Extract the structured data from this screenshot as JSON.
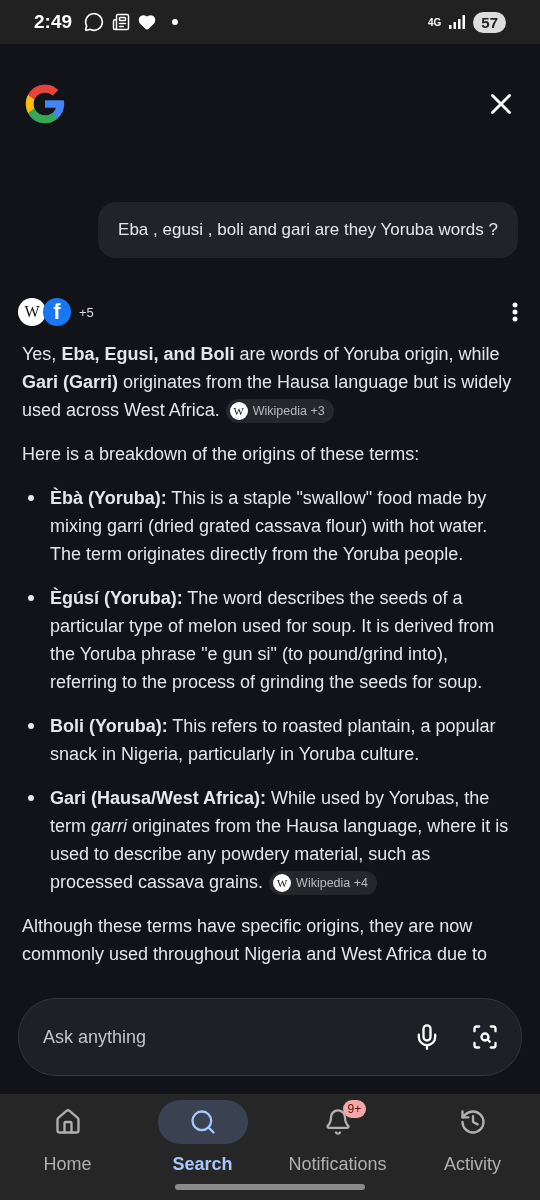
{
  "status_bar": {
    "time": "2:49",
    "network": "4G",
    "battery": "57"
  },
  "query": "Eba , egusi , boli and gari are they Yoruba words ?",
  "sources": {
    "logos": [
      "W",
      "f"
    ],
    "count": "+5"
  },
  "answer": [
    {
      "kind": "paragraph",
      "text": "Yes, **Eba, Egusi, and Boli** are words of Yoruba origin, while **Gari (Garri)** originates from the Hausa language but is widely used across West Africa.",
      "chip": {
        "logo": "W",
        "label": "Wikipedia +3"
      }
    },
    {
      "kind": "paragraph",
      "text": "Here is a breakdown of the origins of these terms:"
    },
    {
      "kind": "bullet",
      "text": "**Èbà (Yoruba):** This is a staple \"swallow\" food made by mixing garri (dried grated cassava flour) with hot water. The term originates directly from the Yoruba people."
    },
    {
      "kind": "bullet",
      "text": "**Ègúsí (Yoruba):** The word describes the seeds of a particular type of melon used for soup. It is derived from the Yoruba phrase \"e gun si\" (to pound/grind into), referring to the process of grinding the seeds for soup."
    },
    {
      "kind": "bullet",
      "text": "**Boli (Yoruba):** This refers to roasted plantain, a popular snack in Nigeria, particularly in Yoruba culture."
    },
    {
      "kind": "bullet",
      "text": "**Gari (Hausa/West Africa):** While used by Yorubas, the term *garri* originates from the Hausa language, where it is used to describe any powdery material, such as processed cassava grains.",
      "chip": {
        "logo": "W",
        "label": "Wikipedia +4"
      }
    },
    {
      "kind": "paragraph",
      "text": "Although these terms have specific origins, they are now commonly used throughout Nigeria and West Africa due to"
    }
  ],
  "ask": {
    "placeholder": "Ask anything"
  },
  "nav": [
    {
      "label": "Home",
      "selected": false
    },
    {
      "label": "Search",
      "selected": true
    },
    {
      "label": "Notifications",
      "selected": false,
      "badge": "9+"
    },
    {
      "label": "Activity",
      "selected": false
    }
  ]
}
